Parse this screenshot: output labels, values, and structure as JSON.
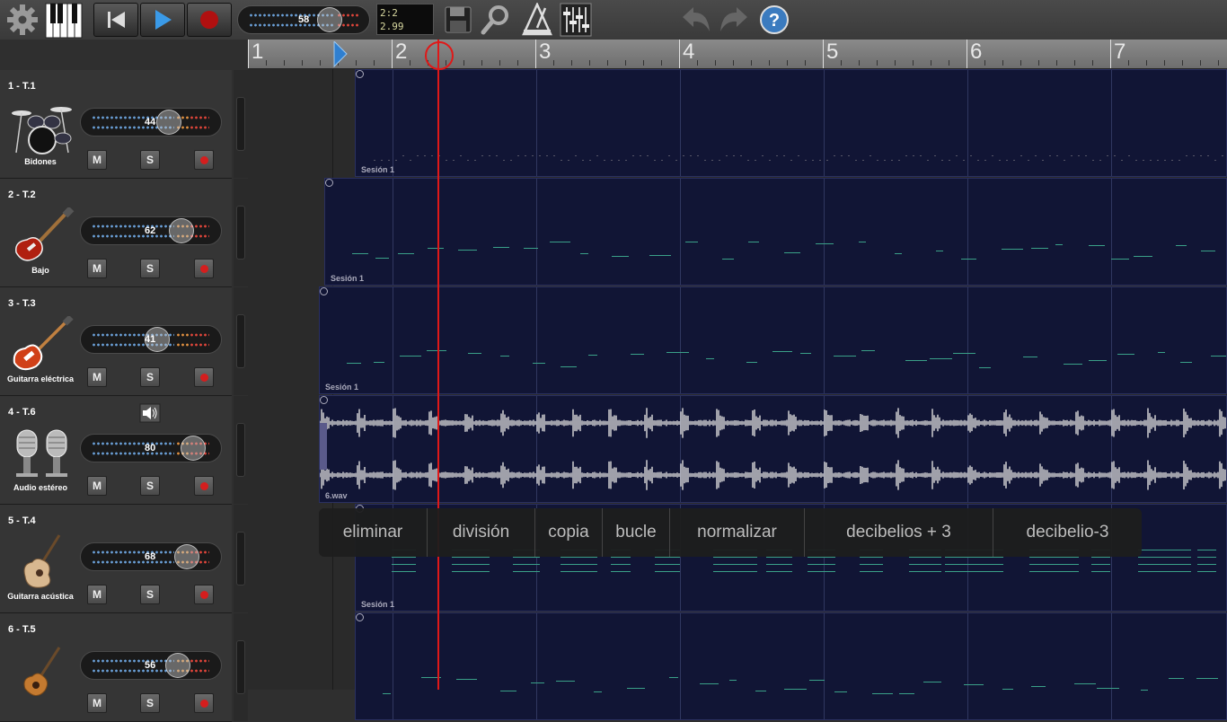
{
  "toolbar": {
    "settings_icon": "gear-icon",
    "piano_icon": "piano-keyboard-icon",
    "rewind_icon": "skip-to-start-icon",
    "play_icon": "play-icon",
    "record_icon": "record-icon",
    "master_volume": "58",
    "time_signature": "2:2",
    "position_time": "2.99",
    "save_icon": "floppy-disk-icon",
    "zoom_icon": "magnifier-icon",
    "metronome_icon": "metronome-icon",
    "mixer_icon": "mixer-icon",
    "undo_icon": "undo-icon",
    "redo_icon": "redo-icon",
    "help_icon": "help-icon"
  },
  "ruler": {
    "bars": [
      "1",
      "2",
      "3",
      "4",
      "5",
      "6",
      "7"
    ]
  },
  "tracks": [
    {
      "id": "1 - T.1",
      "instrument": "Bidones",
      "volume": "44",
      "mute": "M",
      "solo": "S",
      "icon": "drum-kit-icon"
    },
    {
      "id": "2 - T.2",
      "instrument": "Bajo",
      "volume": "62",
      "mute": "M",
      "solo": "S",
      "icon": "bass-guitar-icon"
    },
    {
      "id": "3 - T.3",
      "instrument": "Guitarra eléctrica",
      "volume": "41",
      "mute": "M",
      "solo": "S",
      "icon": "electric-guitar-icon"
    },
    {
      "id": "4 - T.6",
      "instrument": "Audio estéreo",
      "volume": "80",
      "mute": "M",
      "solo": "S",
      "icon": "microphone-icon"
    },
    {
      "id": "5 - T.4",
      "instrument": "Guitarra acústica",
      "volume": "68",
      "mute": "M",
      "solo": "S",
      "icon": "acoustic-guitar-icon"
    },
    {
      "id": "6 - T.5",
      "instrument": "",
      "volume": "56",
      "mute": "M",
      "solo": "S",
      "icon": "ukulele-icon"
    }
  ],
  "clips": [
    {
      "title": "Sesión 1"
    },
    {
      "title": "Sesión 1"
    },
    {
      "title": "Sesión 1"
    },
    {
      "title": "6.wav"
    },
    {
      "title": "Sesión 1"
    },
    {
      "title": ""
    }
  ],
  "context_menu": [
    "eliminar",
    "división",
    "copia",
    "bucle",
    "normalizar",
    "decibelios + 3",
    "decibelio-3"
  ]
}
